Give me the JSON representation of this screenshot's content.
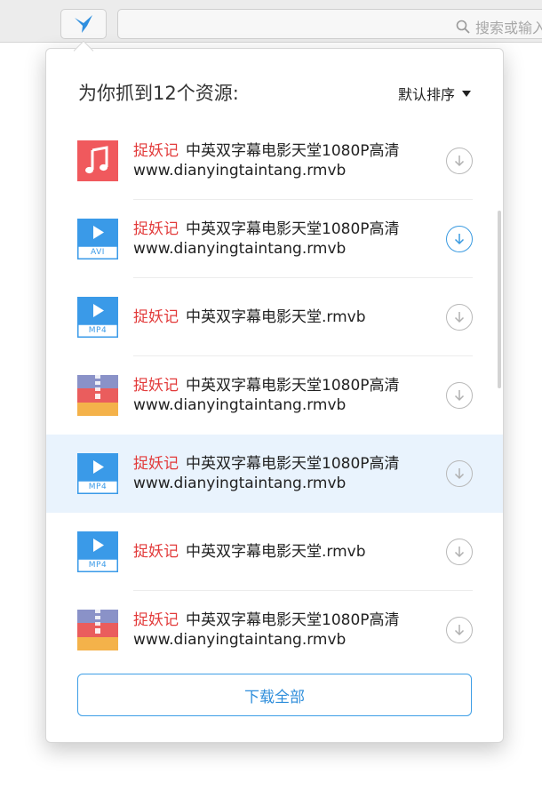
{
  "browser": {
    "search_placeholder": "搜索或输入"
  },
  "popover": {
    "title": "为你抓到12个资源:",
    "sort_label": "默认排序",
    "download_all_label": "下载全部",
    "highlight_color": "#e23a3a",
    "accent_color": "#3d9ee6",
    "items": [
      {
        "icon": "music",
        "badge": "",
        "keyword": "捉妖记",
        "title": "中英双字幕电影天堂1080P高清",
        "subtitle": "www.dianyingtaintang.rmvb",
        "download_active": false,
        "highlighted": false
      },
      {
        "icon": "video",
        "badge": "AVI",
        "keyword": "捉妖记",
        "title": "中英双字幕电影天堂1080P高清",
        "subtitle": "www.dianyingtaintang.rmvb",
        "download_active": true,
        "highlighted": false
      },
      {
        "icon": "video",
        "badge": "MP4",
        "keyword": "捉妖记",
        "title": "中英双字幕电影天堂.rmvb",
        "subtitle": "",
        "download_active": false,
        "highlighted": false
      },
      {
        "icon": "archive",
        "badge": "",
        "keyword": "捉妖记",
        "title": "中英双字幕电影天堂1080P高清",
        "subtitle": "www.dianyingtaintang.rmvb",
        "download_active": false,
        "highlighted": false
      },
      {
        "icon": "video",
        "badge": "MP4",
        "keyword": "捉妖记",
        "title": "中英双字幕电影天堂1080P高清",
        "subtitle": "www.dianyingtaintang.rmvb",
        "download_active": false,
        "highlighted": true
      },
      {
        "icon": "video",
        "badge": "MP4",
        "keyword": "捉妖记",
        "title": "中英双字幕电影天堂.rmvb",
        "subtitle": "",
        "download_active": false,
        "highlighted": false
      },
      {
        "icon": "archive",
        "badge": "",
        "keyword": "捉妖记",
        "title": "中英双字幕电影天堂1080P高清",
        "subtitle": "www.dianyingtaintang.rmvb",
        "download_active": false,
        "highlighted": false
      }
    ]
  }
}
